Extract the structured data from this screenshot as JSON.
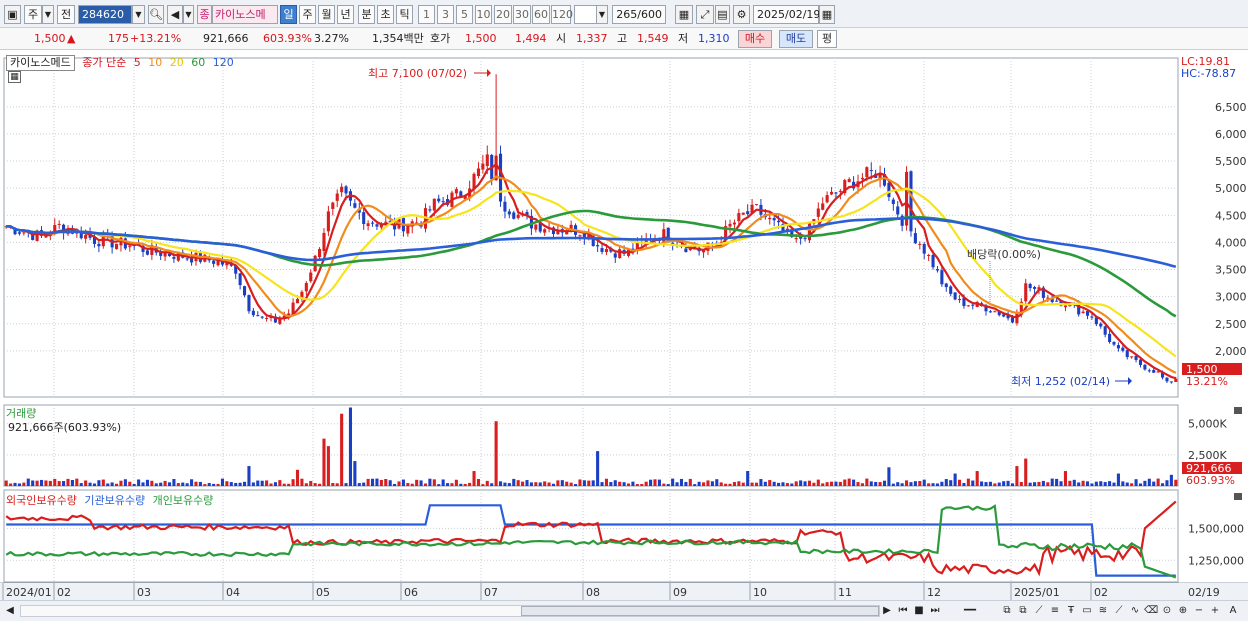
{
  "toolbar": {
    "type_label": "주",
    "prev_label": "전",
    "code": "284620",
    "stock_badge": "종",
    "stock_name": "카이노스메",
    "periods": [
      "일",
      "주",
      "월",
      "년",
      "분",
      "초",
      "틱"
    ],
    "active_period": "일",
    "intervals": [
      "1",
      "3",
      "5",
      "10",
      "20",
      "30",
      "60",
      "120"
    ],
    "count": "265",
    "count_max": "/600",
    "date": "2025/02/19"
  },
  "quote": {
    "price": "1,500",
    "change_arrow": "▲",
    "change": "175",
    "change_pct": "+13.21%",
    "volume": "921,666",
    "volume_ratio": "603.93%",
    "turnover": "3.27%",
    "amount": "1,354백만",
    "bid_label": "호가",
    "ask": "1,500",
    "bid": "1,494",
    "open_label": "시",
    "open": "1,337",
    "high_label": "고",
    "high": "1,549",
    "low_label": "저",
    "low": "1,310",
    "buy_label": "매수",
    "sell_label": "매도",
    "avg_label": "평"
  },
  "price_panel": {
    "legend_name": "카이노스메드",
    "legend_ma": "종가 단순",
    "ma_periods": [
      "5",
      "10",
      "20",
      "60",
      "120"
    ],
    "ma_colors": [
      "#d81e1e",
      "#f08c1c",
      "#f6e41c",
      "#2a9a3a",
      "#2a5fd8"
    ],
    "lc_label": "LC:19.81",
    "hc_label": "HC:-78.87",
    "high_annotation": "최고 7,100 (07/02)",
    "low_annotation": "최저 1,252 (02/14)",
    "dividend_annotation": "배당락(0.00%)",
    "current_price_tag": "1,500",
    "current_change_tag": "13.21%",
    "y_labels": [
      "6,500",
      "6,000",
      "5,500",
      "5,000",
      "4,500",
      "4,000",
      "3,500",
      "3,000",
      "2,500",
      "2,000"
    ]
  },
  "volume_panel": {
    "title": "거래량",
    "value_label": "921,666주(603.93%)",
    "y_labels": [
      "5,000K",
      "2,500K"
    ],
    "current_tag": "921,666",
    "current_pct_tag": "603.93%"
  },
  "holding_panel": {
    "legend": [
      "외국인보유수량",
      "기관보유수량",
      "개인보유수량"
    ],
    "legend_colors": [
      "#d81e1e",
      "#2a5fd8",
      "#2a9a3a"
    ],
    "y_labels": [
      "1,500,000",
      "1,250,000"
    ]
  },
  "x_axis": {
    "labels": [
      "2024/01",
      "02",
      "03",
      "04",
      "05",
      "06",
      "07",
      "08",
      "09",
      "10",
      "11",
      "12",
      "2025/01",
      "02"
    ],
    "last_date": "02/19"
  },
  "chart_data": {
    "type": "candlestick",
    "title": "카이노스메드",
    "y_ticks": [
      2000,
      2500,
      3000,
      3500,
      4000,
      4500,
      5000,
      5500,
      6000,
      6500
    ],
    "ylim": [
      1150,
      7400
    ],
    "months": [
      "2024/01",
      "02",
      "03",
      "04",
      "05",
      "06",
      "07",
      "08",
      "09",
      "10",
      "11",
      "12",
      "2025/01",
      "02"
    ],
    "close_path": [
      [
        0,
        4300
      ],
      [
        4,
        4200
      ],
      [
        8,
        4100
      ],
      [
        12,
        4300
      ],
      [
        16,
        4200
      ],
      [
        20,
        4050
      ],
      [
        24,
        4000
      ],
      [
        28,
        3950
      ],
      [
        32,
        3850
      ],
      [
        36,
        3800
      ],
      [
        40,
        3750
      ],
      [
        44,
        3700
      ],
      [
        48,
        3650
      ],
      [
        52,
        3500
      ],
      [
        55,
        2800
      ],
      [
        58,
        2600
      ],
      [
        61,
        2550
      ],
      [
        64,
        2700
      ],
      [
        67,
        3100
      ],
      [
        70,
        3700
      ],
      [
        73,
        4500
      ],
      [
        76,
        4900
      ],
      [
        79,
        4600
      ],
      [
        82,
        4400
      ],
      [
        85,
        4350
      ],
      [
        88,
        4300
      ],
      [
        91,
        4350
      ],
      [
        94,
        4400
      ],
      [
        97,
        4700
      ],
      [
        100,
        4800
      ],
      [
        103,
        4900
      ],
      [
        106,
        5200
      ],
      [
        109,
        5500
      ],
      [
        111,
        5000
      ],
      [
        113,
        4700
      ],
      [
        116,
        4500
      ],
      [
        119,
        4350
      ],
      [
        122,
        4300
      ],
      [
        125,
        4250
      ],
      [
        128,
        4250
      ],
      [
        131,
        4200
      ],
      [
        134,
        3950
      ],
      [
        137,
        3850
      ],
      [
        140,
        3800
      ],
      [
        143,
        3900
      ],
      [
        146,
        4100
      ],
      [
        149,
        4150
      ],
      [
        152,
        4000
      ],
      [
        155,
        3900
      ],
      [
        158,
        3850
      ],
      [
        161,
        4000
      ],
      [
        164,
        4300
      ],
      [
        167,
        4500
      ],
      [
        170,
        4600
      ],
      [
        173,
        4400
      ],
      [
        176,
        4200
      ],
      [
        179,
        4000
      ],
      [
        182,
        4250
      ],
      [
        185,
        4750
      ],
      [
        188,
        4900
      ],
      [
        191,
        5100
      ],
      [
        194,
        5200
      ],
      [
        197,
        5300
      ],
      [
        199,
        5150
      ],
      [
        201,
        4700
      ],
      [
        204,
        4300
      ],
      [
        207,
        4000
      ],
      [
        210,
        3600
      ],
      [
        213,
        3100
      ],
      [
        216,
        2900
      ],
      [
        219,
        2850
      ],
      [
        222,
        2800
      ],
      [
        225,
        2700
      ],
      [
        228,
        2550
      ],
      [
        231,
        3200
      ],
      [
        234,
        3100
      ],
      [
        237,
        2950
      ],
      [
        240,
        2900
      ],
      [
        243,
        2750
      ],
      [
        246,
        2650
      ],
      [
        249,
        2300
      ],
      [
        252,
        2000
      ],
      [
        255,
        1850
      ],
      [
        258,
        1700
      ],
      [
        261,
        1600
      ],
      [
        263,
        1400
      ],
      [
        265,
        1500
      ]
    ],
    "ma_series_names": [
      "5",
      "10",
      "20",
      "60",
      "120"
    ]
  }
}
